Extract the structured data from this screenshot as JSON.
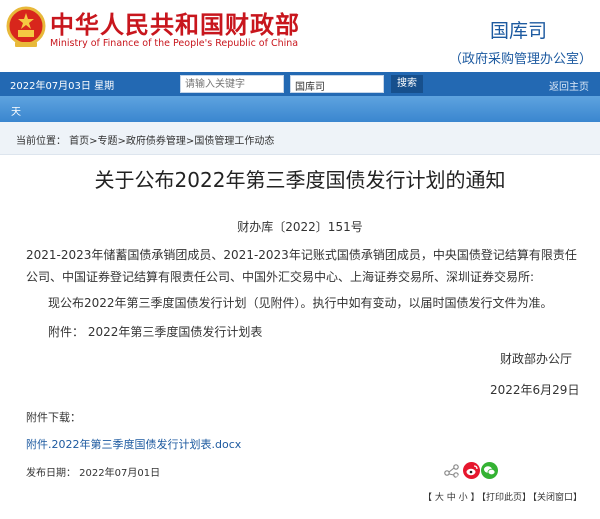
{
  "header": {
    "ministry_cn": "中华人民共和国财政部",
    "ministry_en": "Ministry of Finance of the People's Republic of China",
    "dept_name": "国库司",
    "dept_sub": "（政府采购管理办公室）"
  },
  "topbar": {
    "date_text": "2022年07月03日   星期",
    "keyword_placeholder": "请输入关键字",
    "scope_value": "国库司",
    "search_label": "搜索",
    "back_label": "返回主页"
  },
  "nav": {
    "item_label": "天"
  },
  "breadcrumb": {
    "text": "当前位置：  首页>专题>政府债券管理>国债管理工作动态"
  },
  "article": {
    "title": "关于公布2022年第三季度国债发行计划的通知",
    "doc_number": "财办库〔2022〕151号",
    "recipients": "2021-2023年储蓄国债承销团成员、2021-2023年记账式国债承销团成员，中央国债登记结算有限责任公司、中国证券登记结算有限责任公司、中国外汇交易中心、上海证券交易所、深圳证券交易所:",
    "body": "现公布2022年第三季度国债发行计划（见附件）。执行中如有变动，以届时国债发行文件为准。",
    "attachment_note": "附件：  2022年第三季度国债发行计划表",
    "signer": "财政部办公厅",
    "sign_date": "2022年6月29日",
    "attachments_title": "附件下载：",
    "attachment_link": "附件.2022年第三季度国债发行计划表.docx",
    "publish_date": "发布日期：  2022年07月01日"
  },
  "tools": {
    "size_label": "【 大 中 小 】",
    "print_label": "【打印此页】",
    "close_label": "【关闭窗口】"
  },
  "colors": {
    "brand_red": "#c8161d",
    "brand_blue": "#1d5aa0",
    "topbar_blue": "#2369b3",
    "nav_blue": "#4a93d6"
  }
}
